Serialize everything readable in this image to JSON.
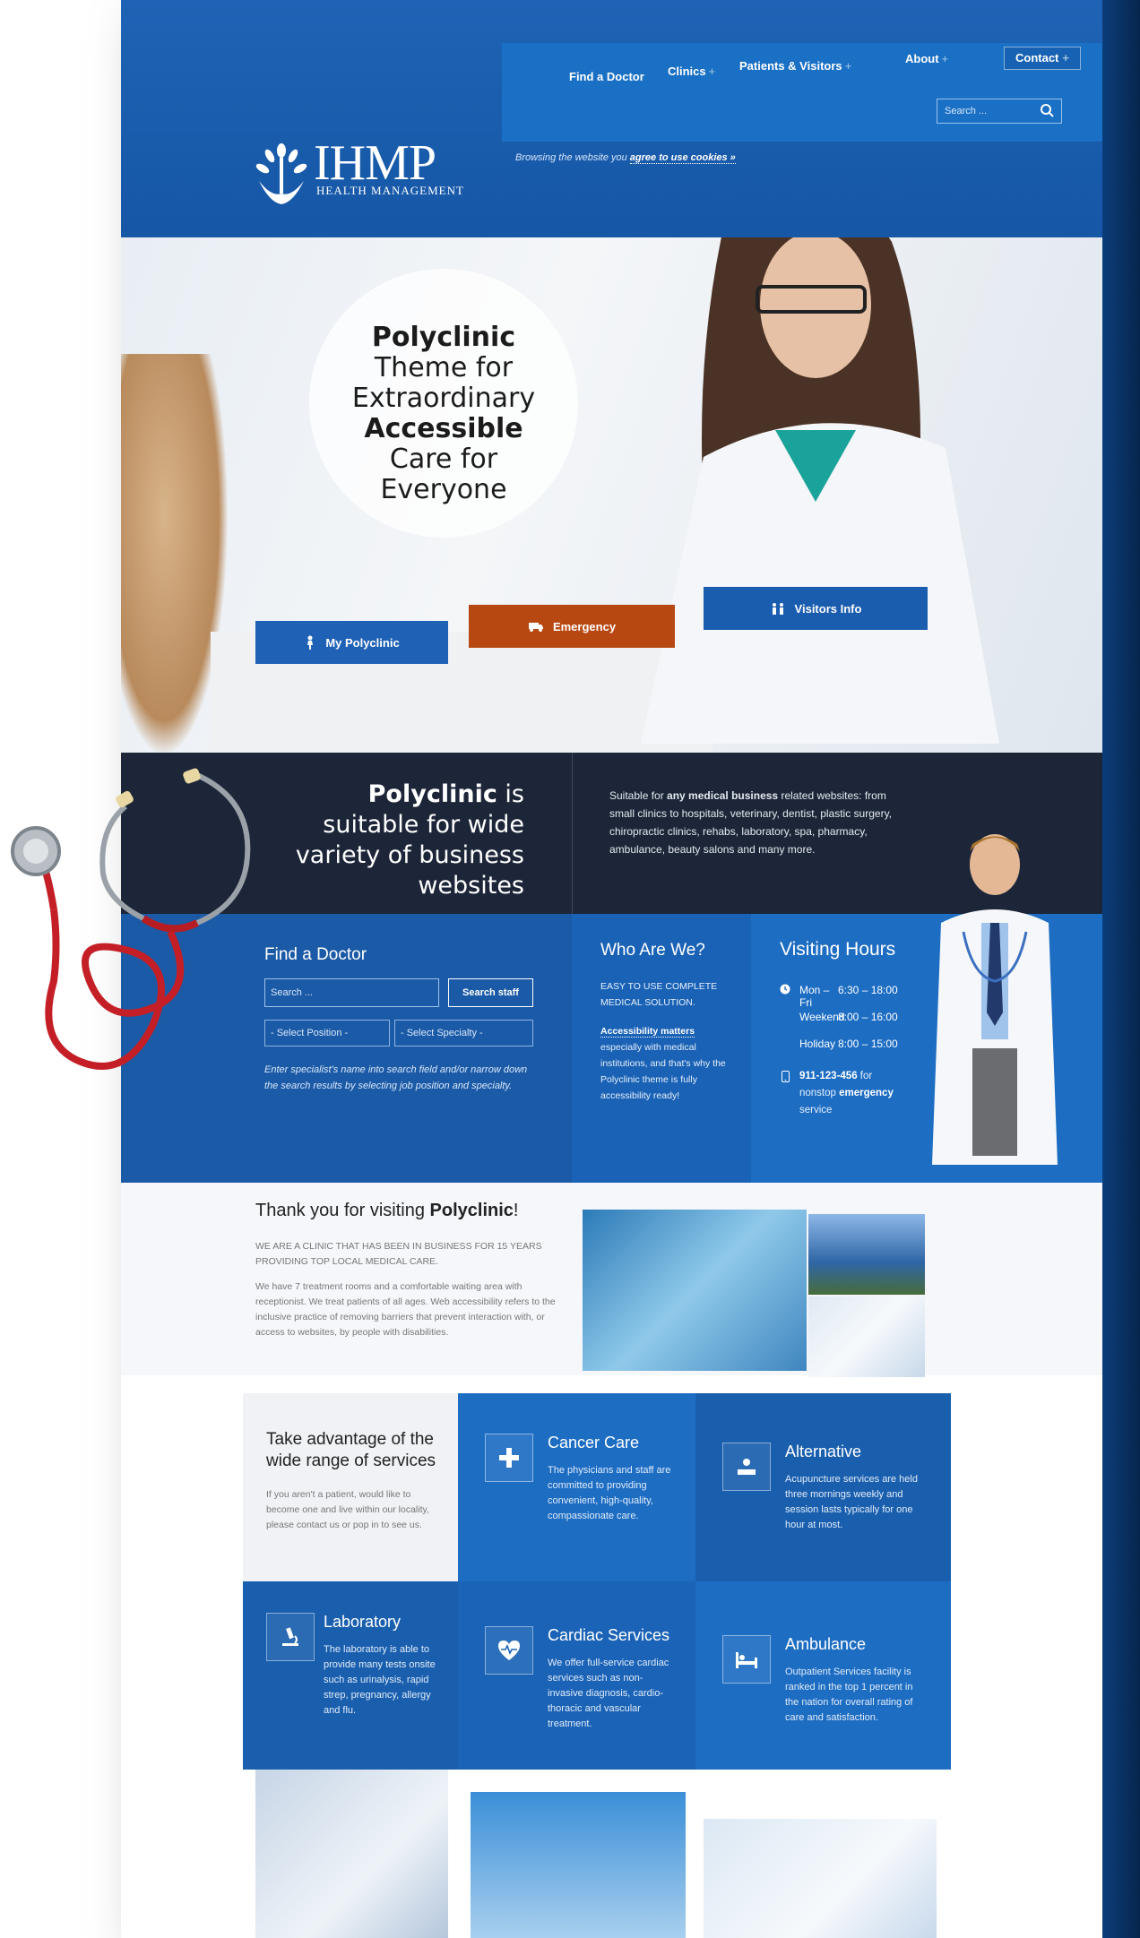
{
  "brand": {
    "logo_text": "IHMP",
    "logo_sub": "HEALTH MANAGEMENT"
  },
  "nav": {
    "items": [
      "Find a Doctor",
      "Clinics",
      "Patients & Visitors",
      "About"
    ],
    "contact": "Contact",
    "search_placeholder": "Search ...",
    "cookie_prefix": "Browsing the website you",
    "cookie_link": "agree to use cookies »"
  },
  "hero": {
    "line1": "Polyclinic",
    "line2": "Theme for",
    "line3": "Extraordinary",
    "line4": "Accessible",
    "line5": "Care for",
    "line6": "Everyone",
    "buttons": {
      "my_polyclinic": "My Polyclinic",
      "emergency": "Emergency",
      "visitors_info": "Visitors Info"
    }
  },
  "suitable": {
    "heading_bold": "Polyclinic",
    "heading_rest": " is suitable for wide variety of business websites",
    "text_prefix": "Suitable for ",
    "text_bold": "any medical business",
    "text_rest": " related websites: from small clinics to hospitals, veterinary, dentist, plastic surgery, chiropractic clinics, rehabs, laboratory, spa, pharmacy, ambulance, beauty salons and many more."
  },
  "find_doctor": {
    "title": "Find a Doctor",
    "search_placeholder": "Search ...",
    "search_button": "Search staff",
    "select_position": "- Select Position -",
    "select_specialty": "- Select Specialty -",
    "hint": "Enter specialist's name into search field and/or narrow down the search results by selecting job position and specialty."
  },
  "who": {
    "title": "Who Are We?",
    "caps": "EASY TO USE COMPLETE MEDICAL SOLUTION.",
    "bold": "Accessibility matters",
    "rest": " especially with medical institutions, and that's why the Polyclinic theme is fully accessibility ready!"
  },
  "hours": {
    "title": "Visiting Hours",
    "rows": [
      {
        "day": "Mon – Fri",
        "time": "6:30 – 18:00"
      },
      {
        "day": "Weekend",
        "time": "8:00 – 16:00"
      },
      {
        "day": "Holiday",
        "time": "8:00 – 15:00"
      }
    ],
    "phone": "911-123-456",
    "phone_for": " for nonstop ",
    "emergency": "emergency",
    "service": " service"
  },
  "welcome": {
    "title_prefix": "Thank you for visiting ",
    "title_bold": "Polyclinic",
    "title_suffix": "!",
    "caps": "We are a clinic that has been in business for 15 years providing top local medical care.",
    "body": "We have 7 treatment rooms and a comfortable waiting area with receptionist. We treat patients of all ages. Web accessibility refers to the inclusive practice of removing barriers that prevent interaction with, or access to websites, by people with disabilities."
  },
  "services": {
    "intro_title": "Take advantage of the wide range of services",
    "intro_text": "If you aren't a patient, would like to become one and live within our locality, please contact us or pop in to see us.",
    "items": [
      {
        "title": "Cancer Care",
        "text": "The physicians and staff are committed to providing convenient, high-quality, compassionate care."
      },
      {
        "title": "Alternative",
        "text": "Acupuncture services are held three mornings weekly and session lasts typically for one hour at most."
      },
      {
        "title": "Laboratory",
        "text": "The laboratory is able to provide many tests onsite such as urinalysis, rapid strep, pregnancy, allergy and flu."
      },
      {
        "title": "Cardiac Services",
        "text": "We offer full-service cardiac services such as non-invasive diagnosis, cardio-thoracic and vascular treatment."
      },
      {
        "title": "Ambulance",
        "text": "Outpatient Services facility is ranked in the top 1 percent in the nation for overall rating of care and satisfaction."
      }
    ]
  },
  "colors": {
    "header_blue": "#1e63b5",
    "dark_band": "#1c2638",
    "emergency_orange": "#b84812",
    "service_blue_a": "#1d6dc3",
    "service_blue_b": "#1a5fae"
  }
}
